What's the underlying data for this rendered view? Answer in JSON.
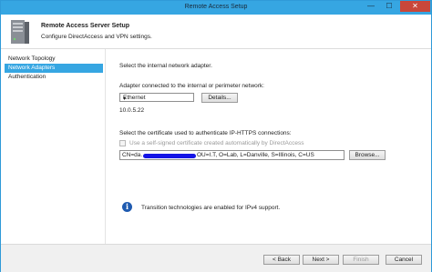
{
  "window": {
    "title": "Remote Access Setup",
    "min": "—",
    "max": "☐",
    "close": "✕"
  },
  "header": {
    "title": "Remote Access Server Setup",
    "subtitle": "Configure DirectAccess and VPN settings."
  },
  "nav": {
    "items": [
      "Network Topology",
      "Network Adapters",
      "Authentication"
    ],
    "selected": "Network Adapters"
  },
  "main": {
    "instruction": "Select the internal network adapter.",
    "adapter_label": "Adapter connected to the internal or perimeter network:",
    "adapter_value": "Ethernet",
    "details_label": "Details...",
    "ip_address": "10.0.5.22",
    "cert_label": "Select the certificate used to authenticate IP-HTTPS connections:",
    "self_signed_label": "Use a self-signed certificate created automatically by DirectAccess",
    "cert_prefix": "CN=da.",
    "cert_suffix": " OU=I.T, O=Lab, L=Danville, S=Illinois, C=US",
    "browse_label": "Browse...",
    "info_text": "Transition technologies are enabled for IPv4 support."
  },
  "footer": {
    "back": "< Back",
    "next": "Next >",
    "finish": "Finish",
    "cancel": "Cancel"
  },
  "colors": {
    "titlebar": "#36a6e2",
    "selection": "#36a6e2",
    "close": "#c9473a",
    "redaction": "#1414e6"
  }
}
